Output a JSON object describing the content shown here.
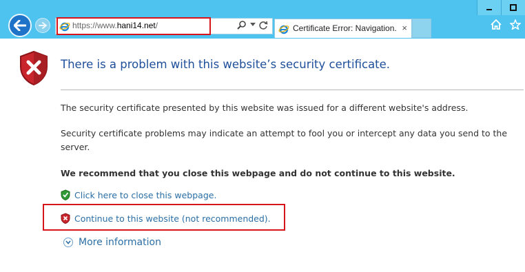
{
  "browser": {
    "url_prefix": "https://www.",
    "url_domain": "hani14.net",
    "url_suffix": "/",
    "tab_title": "Certificate Error: Navigation...",
    "tab_close": "×"
  },
  "page": {
    "heading": "There is a problem with this website’s security certificate.",
    "para1": "The security certificate presented by this website was issued for a different website's address.",
    "para2": "Security certificate problems may indicate an attempt to fool you or intercept any data you send to the server.",
    "recommend": "We recommend that you close this webpage and do not continue to this website.",
    "close_link": "Click here to close this webpage.",
    "continue_link": "Continue to this website (not recommended).",
    "more_info": "More information"
  },
  "colors": {
    "accent": "#1e4f9a",
    "link": "#2a6ea5",
    "highlight_border": "#d8141b",
    "chrome": "#4fc3ef"
  },
  "icons": {
    "back": "back-arrow-icon",
    "forward": "forward-arrow-icon",
    "ie": "ie-logo-icon",
    "search": "search-icon",
    "dropdown": "dropdown-icon",
    "refresh": "refresh-icon",
    "home": "home-icon",
    "favorites": "star-icon",
    "error_shield": "red-shield-icon",
    "safe_shield": "green-shield-icon",
    "expand": "chevron-down-icon"
  }
}
